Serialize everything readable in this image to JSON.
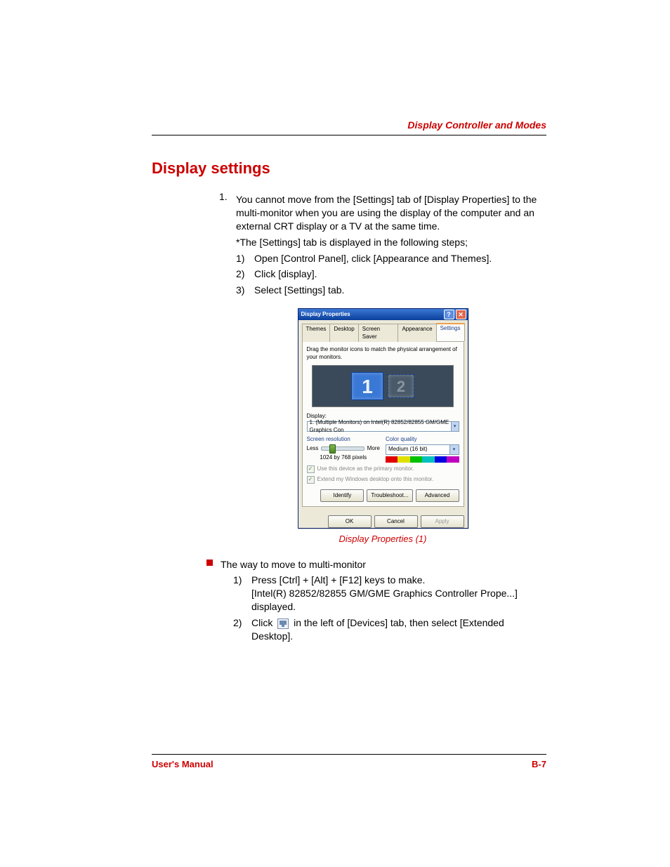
{
  "header": {
    "chapter_title": "Display Controller and Modes"
  },
  "section": {
    "title": "Display settings"
  },
  "list1": {
    "marker": "1.",
    "para1": "You cannot move from the [Settings] tab of [Display Properties] to the multi-monitor when you are using the display of the computer and an external CRT display or a TV at the same time.",
    "para2": "*The [Settings] tab is displayed in the following steps;",
    "steps": [
      {
        "marker": "1)",
        "text": "Open [Control Panel], click [Appearance and Themes]."
      },
      {
        "marker": "2)",
        "text": "Click [display]."
      },
      {
        "marker": "3)",
        "text": "Select [Settings] tab."
      }
    ]
  },
  "dialog": {
    "title": "Display Properties",
    "help": "?",
    "close": "✕",
    "tabs": [
      "Themes",
      "Desktop",
      "Screen Saver",
      "Appearance",
      "Settings"
    ],
    "active_tab": 4,
    "instruction": "Drag the monitor icons to match the physical arrangement of your monitors.",
    "monitor1": "1",
    "monitor2": "2",
    "display_label": "Display:",
    "display_value": "1. (Multiple Monitors) on Intel(R) 82852/82855 GM/GME Graphics Con",
    "res_label": "Screen resolution",
    "res_less": "Less",
    "res_more": "More",
    "res_value": "1024 by 768 pixels",
    "cq_label": "Color quality",
    "cq_value": "Medium (16 bit)",
    "chk_primary": "Use this device as the primary monitor.",
    "chk_extend": "Extend my Windows desktop onto this monitor.",
    "btn_identify": "Identify",
    "btn_trouble": "Troubleshoot...",
    "btn_adv": "Advanced",
    "btn_ok": "OK",
    "btn_cancel": "Cancel",
    "btn_apply": "Apply"
  },
  "caption": "Display Properties (1)",
  "bullet": {
    "heading": "The way to move to multi-monitor",
    "steps": [
      {
        "marker": "1)",
        "line1": "Press [Ctrl] + [Alt] + [F12] keys to make.",
        "line2": "[Intel(R) 82852/82855 GM/GME Graphics Controller Prope...] displayed."
      },
      {
        "marker": "2)",
        "pre": "Click ",
        "post": " in the left of [Devices] tab, then select [Extended Desktop]."
      }
    ]
  },
  "footer": {
    "left": "User's Manual",
    "right": "B-7"
  }
}
